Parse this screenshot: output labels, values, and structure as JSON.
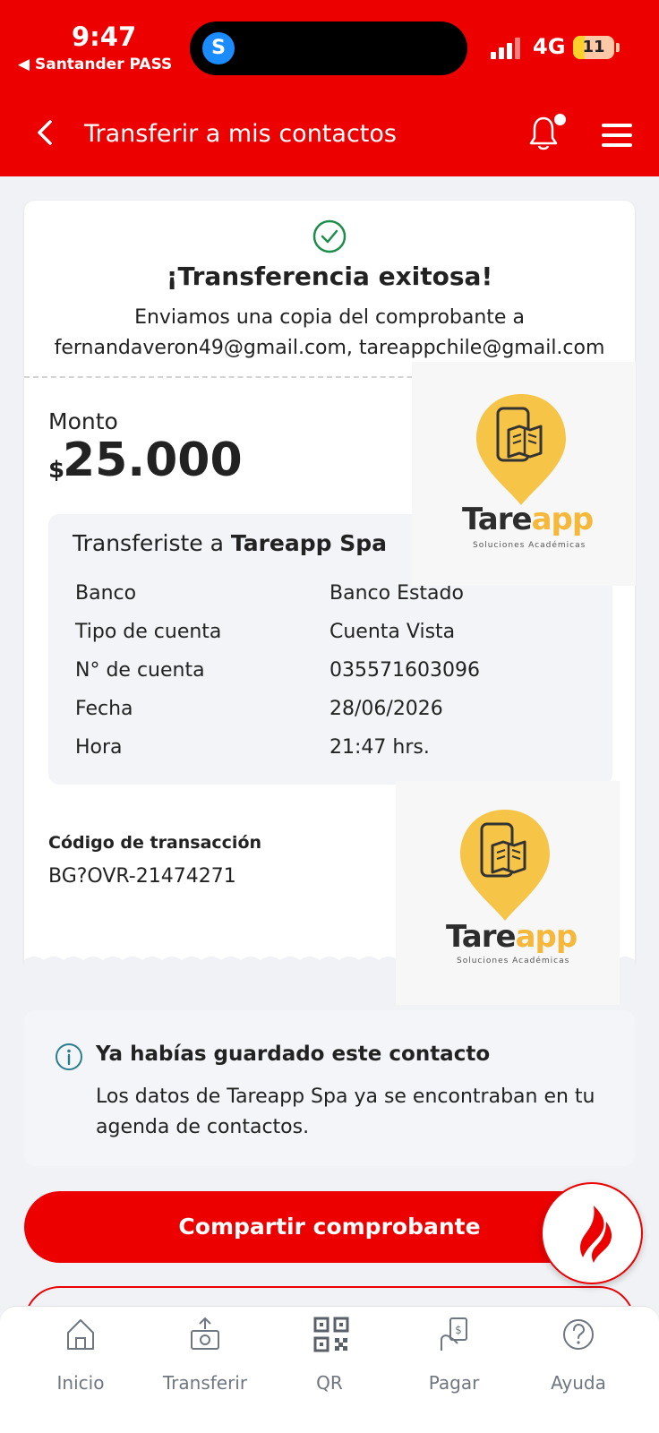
{
  "status_bar": {
    "time": "9:47",
    "back_app": "◀ Santander PASS",
    "network": "4G",
    "battery": "11"
  },
  "header": {
    "title": "Transferir a mis contactos"
  },
  "receipt": {
    "success_title": "¡Transferencia exitosa!",
    "success_line1": "Enviamos una copia del comprobante a",
    "success_line2": "fernandaveron49@gmail.com, tareappchile@gmail.com",
    "amount_label": "Monto",
    "currency": "$",
    "amount": "25.000",
    "recipient_prefix": "Transferiste a ",
    "recipient_name": "Tareapp Spa",
    "rows": [
      {
        "label": "Banco",
        "value": "Banco Estado"
      },
      {
        "label": "Tipo de cuenta",
        "value": "Cuenta Vista"
      },
      {
        "label": "N° de cuenta",
        "value": "035571603096"
      },
      {
        "label": "Fecha",
        "value": "28/06/2026"
      },
      {
        "label": "Hora",
        "value": "21:47 hrs."
      }
    ],
    "code_label": "Código de transacción",
    "code_value": "BG?OVR-21474271"
  },
  "watermark": {
    "word_dark": "Tare",
    "word_accent": "app",
    "tagline": "Soluciones Académicas"
  },
  "info": {
    "title": "Ya habías guardado este contacto",
    "body": "Los datos de Tareapp Spa ya se encontraban en tu agenda de contactos."
  },
  "actions": {
    "share_label": "Compartir comprobante"
  },
  "tabs": [
    {
      "label": "Inicio",
      "icon": "home-icon"
    },
    {
      "label": "Transferir",
      "icon": "transfer-icon"
    },
    {
      "label": "QR",
      "icon": "qr-icon"
    },
    {
      "label": "Pagar",
      "icon": "pay-icon"
    },
    {
      "label": "Ayuda",
      "icon": "help-icon"
    }
  ],
  "colors": {
    "brand_red": "#ec0000",
    "success_green": "#1e8c4a",
    "info_teal": "#2a7d8c",
    "logo_yellow": "#f6c446"
  }
}
